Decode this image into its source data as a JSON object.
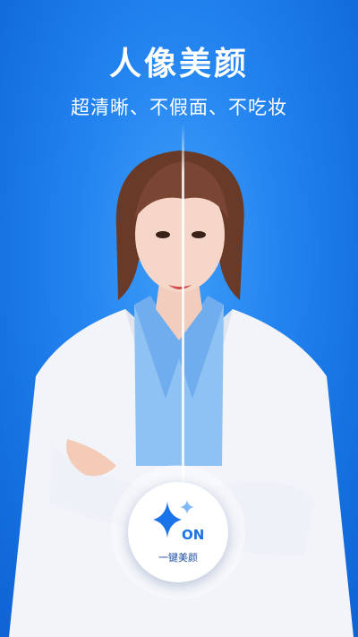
{
  "header": {
    "title": "人像美颜",
    "subtitle": "超清晰、不假面、不吃妆"
  },
  "beauty_toggle": {
    "state": "ON",
    "label": "一键美颜",
    "icon": "sparkle-icon"
  },
  "colors": {
    "background": "#2384f0",
    "accent": "#1a73e8",
    "coat": "#f3f5fa",
    "shirt": "#8ec2f4"
  }
}
